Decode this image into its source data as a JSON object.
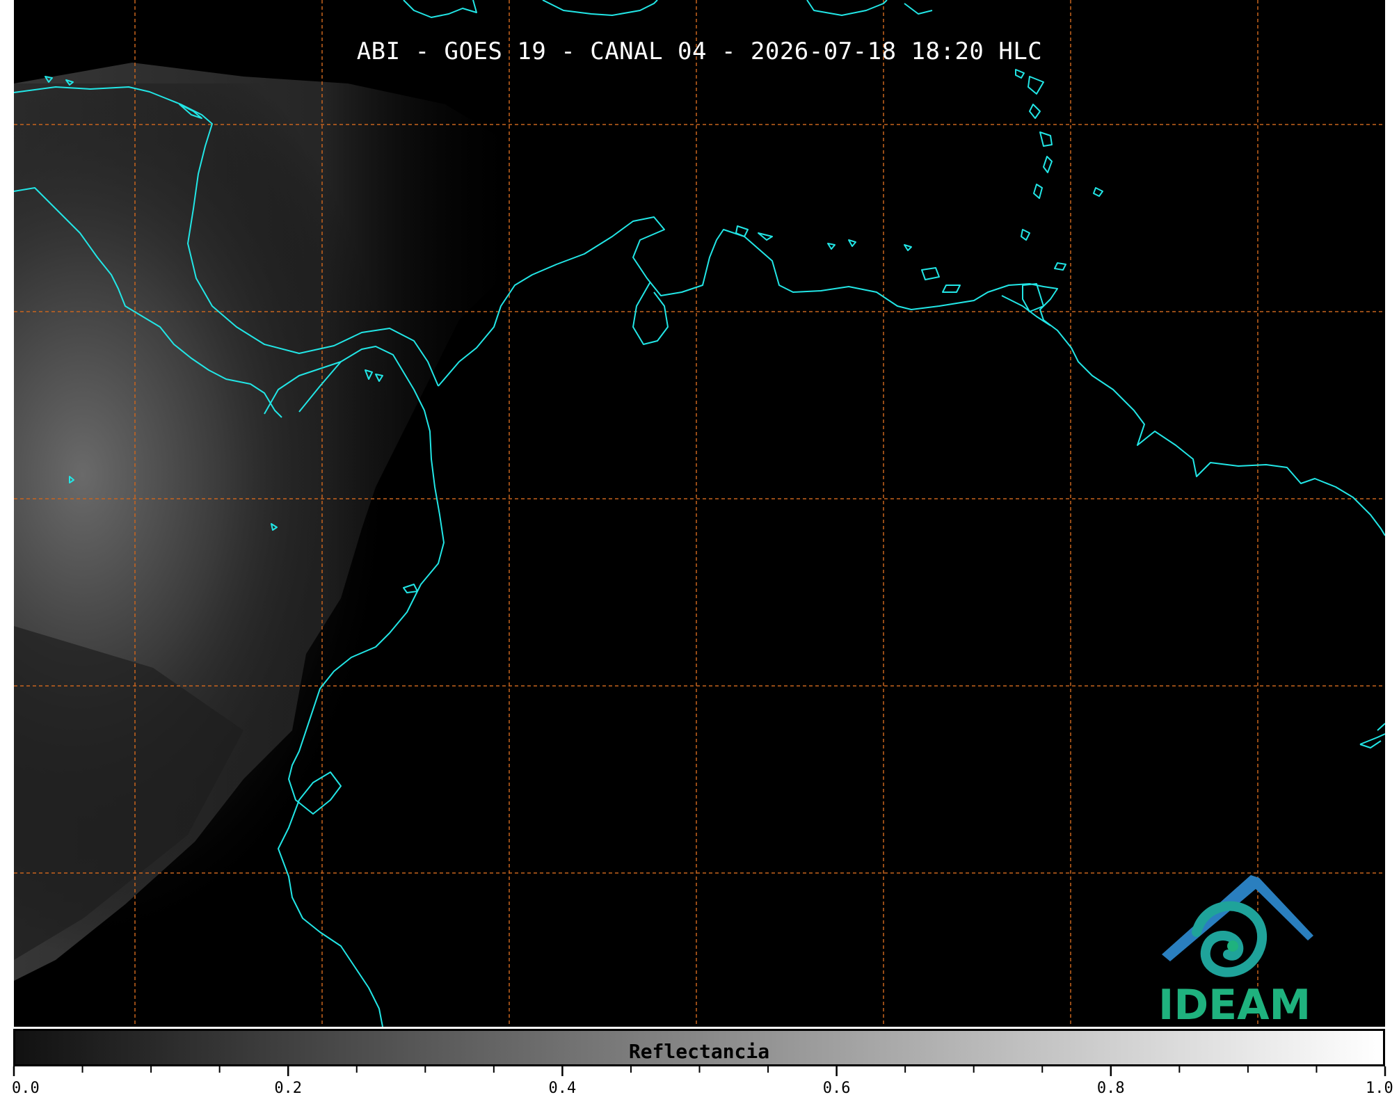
{
  "title": "ABI - GOES 19 - CANAL 04 - 2026-07-18 18:20 HLC",
  "logo": {
    "text": "IDEAM",
    "color": "#1fb27e"
  },
  "colors": {
    "background": "#000000",
    "coastline": "#22e6e6",
    "gridline": "#c8641e"
  },
  "colorbar": {
    "label": "Reflectancia",
    "gradient": [
      "#111111",
      "#ffffff"
    ],
    "ticks": [
      "0.0",
      "0.2",
      "0.4",
      "0.6",
      "0.8",
      "1.0"
    ],
    "range": [
      0.0,
      1.0
    ]
  }
}
